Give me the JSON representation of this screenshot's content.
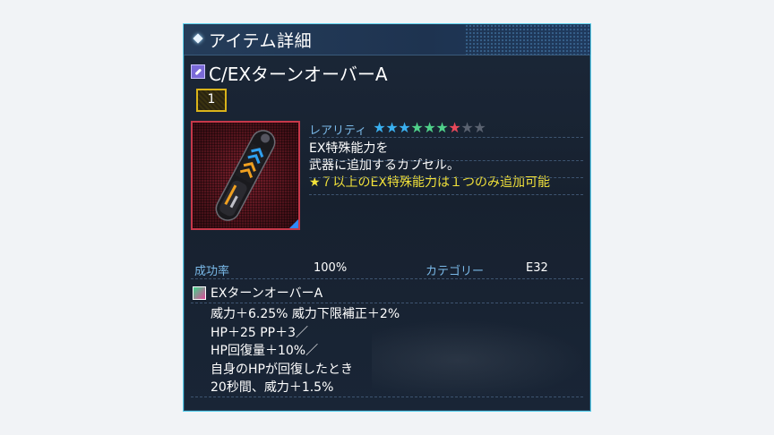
{
  "window": {
    "title": "アイテム詳細"
  },
  "item": {
    "name": "C/EXターンオーバーA",
    "quantity": "1",
    "image_icon": "capsule-icon"
  },
  "rarity": {
    "label": "レアリティ",
    "stars_total": 9,
    "stars_filled": 7,
    "star_colors": [
      "#3ab0f0",
      "#3ab0f0",
      "#3ab0f0",
      "#4fd08a",
      "#4fd08a",
      "#4fd08a",
      "#e8485a",
      "#5a6270",
      "#5a6270"
    ]
  },
  "description": {
    "line1": "EX特殊能力を",
    "line2": "武器に追加するカプセル。",
    "note": "★７以上のEX特殊能力は１つのみ追加可能"
  },
  "stats": {
    "success_label": "成功率",
    "success_value": "100%",
    "category_label": "カテゴリー",
    "category_value": "E32"
  },
  "ability": {
    "name": "EXターンオーバーA",
    "lines": [
      "威力＋6.25%  威力下限補正＋2%",
      "HP＋25  PP＋3／",
      "HP回復量＋10%／",
      "自身のHPが回復したとき",
      "20秒間、威力＋1.5%"
    ]
  },
  "colors": {
    "panel_border": "#5fd3f0",
    "label_blue": "#7ab9e8",
    "note_yellow": "#f2e23a",
    "image_border": "#c8384a"
  }
}
